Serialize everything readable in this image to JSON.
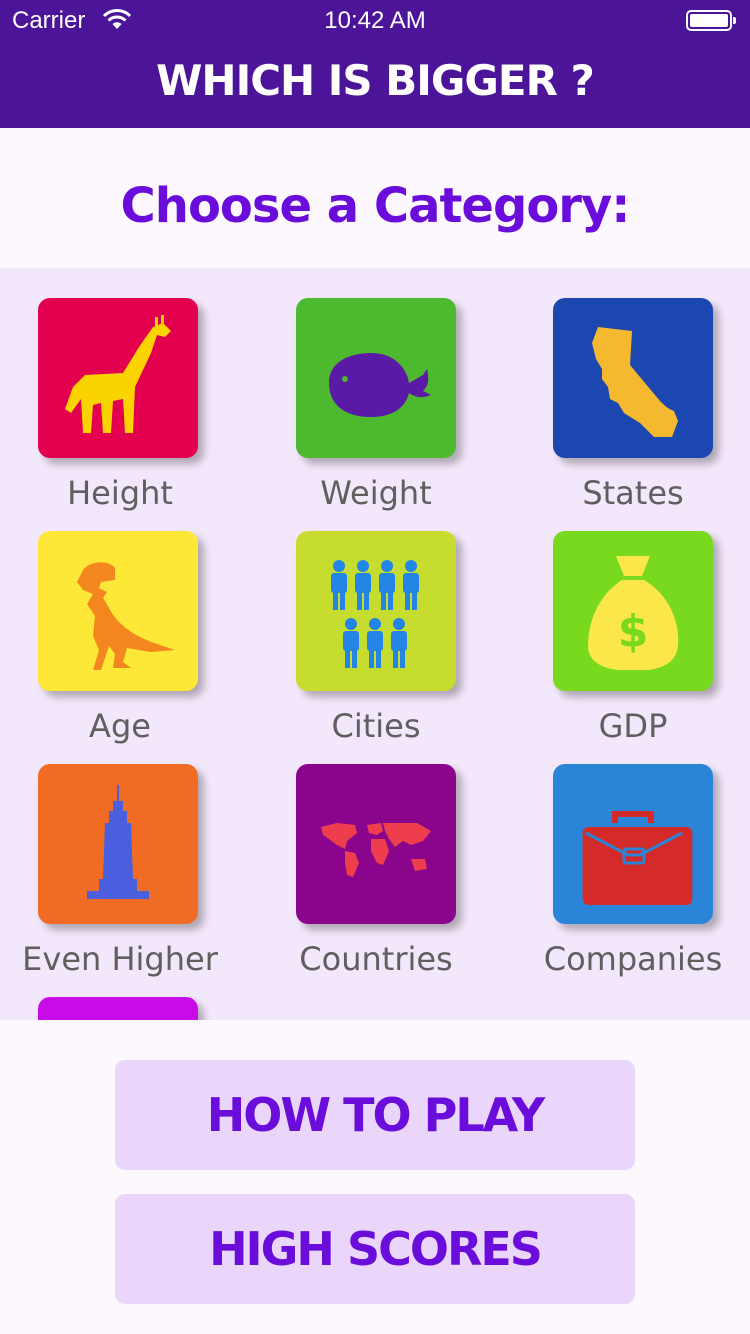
{
  "status_bar": {
    "carrier": "Carrier",
    "time": "10:42 AM",
    "wifi_icon": "wifi-icon",
    "battery_icon": "battery-icon"
  },
  "header": {
    "title": "WHICH IS BIGGER ?",
    "background": "#4c1599"
  },
  "subtitle": "Choose a Category:",
  "categories": [
    {
      "label": "Height",
      "icon": "giraffe-icon",
      "tile_color": "#e3004f",
      "icon_color": "#fbd400"
    },
    {
      "label": "Weight",
      "icon": "whale-icon",
      "tile_color": "#4cb92e",
      "icon_color": "#5a1aa6"
    },
    {
      "label": "States",
      "icon": "california-icon",
      "tile_color": "#1d47b0",
      "icon_color": "#f4b92e"
    },
    {
      "label": "Age",
      "icon": "dinosaur-icon",
      "tile_color": "#fde838",
      "icon_color": "#f4861f"
    },
    {
      "label": "Cities",
      "icon": "people-icon",
      "tile_color": "#c6dc2f",
      "icon_color": "#2385e6"
    },
    {
      "label": "GDP",
      "icon": "money-bag-icon",
      "tile_color": "#78d91f",
      "icon_color": "#fbe74a"
    },
    {
      "label": "Even Higher",
      "icon": "skyscraper-icon",
      "tile_color": "#f06c24",
      "icon_color": "#4a5ee0"
    },
    {
      "label": "Countries",
      "icon": "world-map-icon",
      "tile_color": "#8a058c",
      "icon_color": "#ee3e4e"
    },
    {
      "label": "Companies",
      "icon": "briefcase-icon",
      "tile_color": "#2a85d8",
      "icon_color": "#d42a2a"
    },
    {
      "label": "",
      "icon": "",
      "tile_color": "#c80ce8",
      "icon_color": ""
    }
  ],
  "buttons": {
    "how_to_play": "HOW TO PLAY",
    "high_scores": "HIGH SCORES"
  }
}
